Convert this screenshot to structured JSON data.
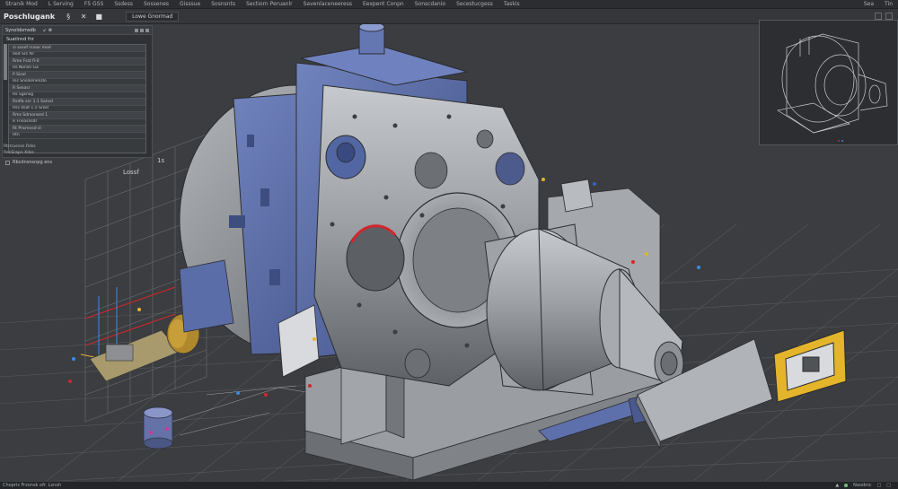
{
  "menubar": {
    "left_items": [
      "Stranik Mod",
      "L Serving",
      "F5 GSS",
      "Ssdess",
      "Sossenes",
      "Gisssue",
      "Sosnsnts",
      "Sectiorn Peruanlr",
      "Savenlaceneeress",
      "Eexpent Conpn",
      "Sonscdanio",
      "Secestucgess",
      "Taskis"
    ],
    "right_items": [
      "Sea",
      "Tin"
    ]
  },
  "toolbar": {
    "app_title": "Poschlugank",
    "buttons": [
      "§",
      "✕",
      "■"
    ],
    "tab_label": "Lowe Gnormad"
  },
  "panel": {
    "title": "Synoldomsdb",
    "title_extra": "↙ ⊗",
    "tree_label": "Suatlnnd fnr",
    "rows": [
      "⊙ ssoof   rsioor mod",
      "Rod  Srs   fsl",
      "Rme   Fsst   fl-0",
      "Rs  Nonsn   Ga",
      "P  Sisol",
      "Ris  Snolsenenzlo",
      "R  Sesosr",
      "Rs  Sgsnsg",
      "Rsdfa  snr   1.1   Sansd",
      "Rss   dsat   1.5   Srsel",
      "Rms    Sdrsonsed   1",
      "R  Fnsosnsdr",
      "Rt  Pnsmnsd   sl",
      "Rtn"
    ],
    "footer_rows": [
      "Rtrrrusnsn  Rdss",
      "RenSrapn  Xdss"
    ],
    "checkbox_label": "Rbcdnsnsnpg  ens"
  },
  "viewport": {
    "axis_label": "1s",
    "view_label": "Lossf"
  },
  "statusbar": {
    "left_text": "Chopris  Frzonsk  ofr. Lsnsh",
    "right_text": "Naodnic",
    "right_icons": [
      "▲",
      "□",
      "□"
    ]
  },
  "colors": {
    "machine_steel": "#8c8f93",
    "housing_blue": "#5a6fa8",
    "accent_yellow": "#e4b52b",
    "accent_red": "#d2262c",
    "grid": "#56595d"
  }
}
